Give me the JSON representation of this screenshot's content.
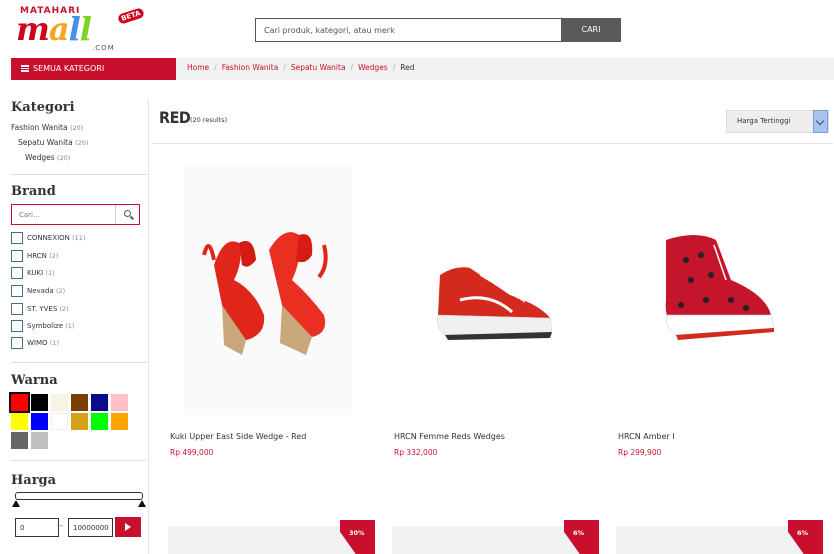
{
  "logo": {
    "brand_small_1": "MATAHARI",
    "brand_big": [
      "m",
      "a",
      "l",
      "l"
    ],
    "brand_com": ".COM",
    "badge": "BETA"
  },
  "search": {
    "placeholder": "Cari produk, kategori, atau merk",
    "button_label": "CARI"
  },
  "nav": {
    "all_categories_label": "SEMUA KATEGORI",
    "breadcrumbs": [
      "Home",
      "Fashion Wanita",
      "Sepatu Wanita",
      "Wedges"
    ],
    "current": "Red"
  },
  "sidebar": {
    "kategori": {
      "title": "Kategori",
      "items": [
        {
          "label": "Fashion Wanita",
          "count": "(20)"
        },
        {
          "label": "Sepatu Wanita",
          "count": "(20)"
        },
        {
          "label": "Wedges",
          "count": "(20)"
        }
      ]
    },
    "brand": {
      "title": "Brand",
      "search_placeholder": "Cari...",
      "items": [
        {
          "label": "CONNEXION",
          "count": "(11)"
        },
        {
          "label": "HRCN",
          "count": "(2)"
        },
        {
          "label": "KUKI",
          "count": "(1)"
        },
        {
          "label": "Nevada",
          "count": "(2)"
        },
        {
          "label": "ST. YVES",
          "count": "(2)"
        },
        {
          "label": "Symbolize",
          "count": "(1)"
        },
        {
          "label": "WIMO",
          "count": "(1)"
        }
      ]
    },
    "warna": {
      "title": "Warna",
      "colors": [
        "#ff0000",
        "#000000",
        "#f7f4e1",
        "#7b3f00",
        "#0a0a8a",
        "#ffc0cb",
        "#ffff00",
        "#0000ff",
        "#ffffff",
        "#d4a017",
        "#00ff00",
        "#ffa500",
        "#666666",
        "#c0c0c0"
      ],
      "selected_index": 0
    },
    "harga": {
      "title": "Harga",
      "min": "0",
      "max": "10000000"
    }
  },
  "main": {
    "title": "RED",
    "results": "(20 results)",
    "sort_label": "Harga Tertinggi",
    "products": [
      {
        "name": "Kuki Upper East Side Wedge - Red",
        "price": "Rp 499,000"
      },
      {
        "name": "HRCN Femme Reds Wedges",
        "price": "Rp 332,000"
      },
      {
        "name": "HRCN Amber I",
        "price": "Rp 299,900"
      }
    ],
    "discount_badges": [
      "30%",
      "6%",
      "6%"
    ]
  }
}
